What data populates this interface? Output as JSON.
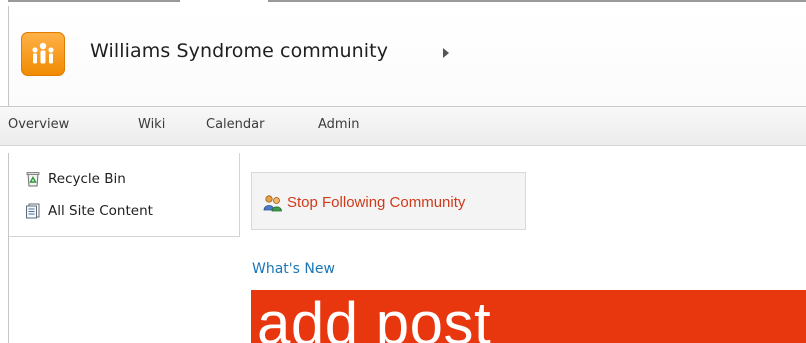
{
  "header": {
    "site_title": "Williams Syndrome community",
    "logo_icon": "community-people-icon",
    "title_menu_icon": "caret-right-icon"
  },
  "topnav": {
    "items": [
      {
        "label": "Overview"
      },
      {
        "label": "Wiki"
      },
      {
        "label": "Calendar"
      },
      {
        "label": "Admin"
      }
    ]
  },
  "quicklaunch": {
    "items": [
      {
        "label": "Recycle Bin",
        "icon": "recycle-bin-icon"
      },
      {
        "label": "All Site Content",
        "icon": "site-content-icon"
      }
    ]
  },
  "main": {
    "follow_button": {
      "label": "Stop Following Community",
      "icon": "people-icon"
    },
    "section_heading": "What's New",
    "add_post_label": "add post"
  },
  "colors": {
    "logo": "#f59a1b",
    "follow_text": "#d03a1a",
    "link_blue": "#1a76b8",
    "add_post_bg": "#e8360e"
  }
}
